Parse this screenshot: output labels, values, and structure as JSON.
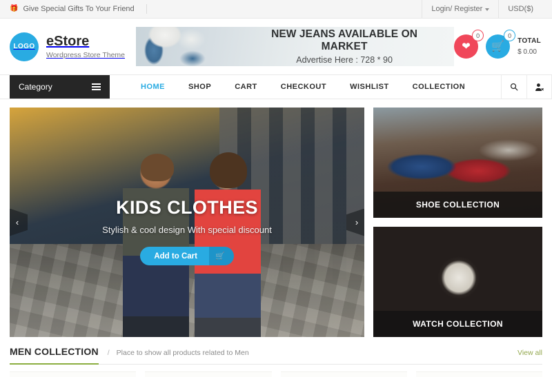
{
  "topbar": {
    "gift_icon": "gift-icon",
    "promo_text": "Give Special Gifts To Your Friend",
    "account_label": "Login/ Register",
    "currency_label": "USD($)"
  },
  "header": {
    "logo_text": "LOGO",
    "brand_name": "eStore",
    "brand_tagline": "Wordpress Store Theme",
    "banner": {
      "title": "NEW JEANS AVAILABLE ON MARKET",
      "subtitle": "Advertise Here : 728 * 90"
    },
    "wishlist": {
      "icon": "heart-icon",
      "count": "0",
      "color": "#f0475a"
    },
    "cart": {
      "icon": "cart-icon",
      "count": "0",
      "color": "#29abe2"
    },
    "total_label": "TOTAL",
    "total_amount": "$ 0.00"
  },
  "nav": {
    "category_label": "Category",
    "menu_icon": "hamburger-icon",
    "items": [
      {
        "label": "HOME",
        "active": true
      },
      {
        "label": "SHOP",
        "active": false
      },
      {
        "label": "CART",
        "active": false
      },
      {
        "label": "CHECKOUT",
        "active": false
      },
      {
        "label": "WISHLIST",
        "active": false
      },
      {
        "label": "COLLECTION",
        "active": false
      }
    ],
    "search_icon": "search-icon",
    "account_icon": "user-logout-icon",
    "active_color": "#29abe2"
  },
  "hero": {
    "title": "KIDS CLOTHES",
    "subtitle": "Stylish & cool design With special discount",
    "button_label": "Add to Cart",
    "button_icon": "cart-icon",
    "prev_icon": "chevron-left-icon",
    "next_icon": "chevron-right-icon",
    "prev_glyph": "‹",
    "next_glyph": "›"
  },
  "collections": [
    {
      "caption": "SHOE COLLECTION"
    },
    {
      "caption": "WATCH COLLECTION"
    }
  ],
  "section": {
    "title": "MEN COLLECTION",
    "slash": "/",
    "description": "Place to show all products related to Men",
    "view_all": "View all",
    "accent_color": "#8bae3f"
  }
}
